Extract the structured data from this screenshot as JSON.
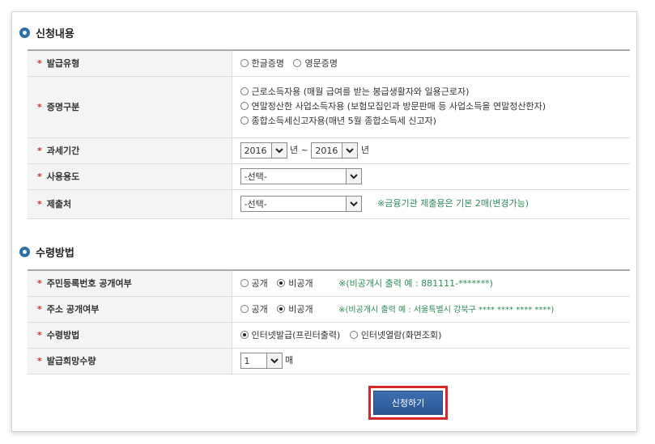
{
  "section1": {
    "title": "신청내용",
    "rows": {
      "issue_type": {
        "label": "발급유형",
        "options": [
          "한글증명",
          "영문증명"
        ]
      },
      "cert_type": {
        "label": "증명구분",
        "options": [
          "근로소득자용 (매월 급여를 받는 봉급생활자와 일용근로자)",
          "연말정산한 사업소득자용 (보험모집인과 방문판매 등 사업소득을 연말정산한자)",
          "종합소득세신고자용(매년 5월 종합소득세 신고자)"
        ]
      },
      "tax_period": {
        "label": "과세기간",
        "from_year": "2016",
        "unit1": "년",
        "sep": "~",
        "to_year": "2016",
        "unit2": "년"
      },
      "purpose": {
        "label": "사용용도",
        "value": "-선택-"
      },
      "submit_to": {
        "label": "제출처",
        "value": "-선택-",
        "note": "※금융기관 제출용은 기본 2매(변경가능)"
      }
    }
  },
  "section2": {
    "title": "수령방법",
    "rows": {
      "rrn_disclosure": {
        "label": "주민등록번호 공개여부",
        "options": [
          "공개",
          "비공개"
        ],
        "selected": "비공개",
        "note": "※(비공개시 출력 예 : 881111-*******)"
      },
      "address_disclosure": {
        "label": "주소 공개여부",
        "options": [
          "공개",
          "비공개"
        ],
        "selected": "비공개",
        "note": "※(비공개시 출력 예 : 서울특별시 강북구 **** **** **** ****)"
      },
      "receive_method": {
        "label": "수령방법",
        "options": [
          "인터넷발급(프린터출력)",
          "인터넷열람(화면조회)"
        ],
        "selected": "인터넷발급(프린터출력)"
      },
      "quantity": {
        "label": "발급희망수량",
        "value": "1",
        "unit": "매"
      }
    }
  },
  "submit_label": "신청하기",
  "colors": {
    "required": "#c0392b",
    "note": "#2e8b57",
    "button": "#2b5795",
    "highlight": "#d6272d"
  }
}
